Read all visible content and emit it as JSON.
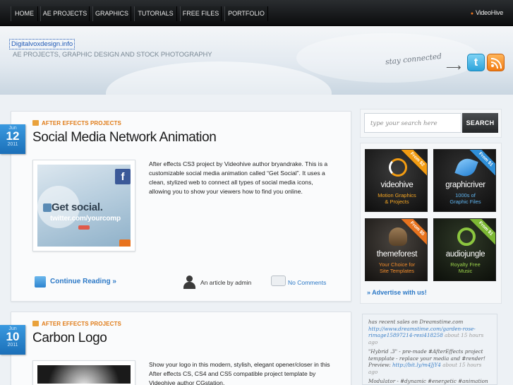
{
  "nav": {
    "items": [
      "HOME",
      "AE PROJECTS",
      "GRAPHICS",
      "TUTORIALS",
      "FREE FILES",
      "PORTFOLIO"
    ],
    "right_link": "VideoHive"
  },
  "header": {
    "site_title": "Digitalvoxdesign.info",
    "tagline": "AE PROJECTS, GRAPHIC DESIGN AND STOCK PHOTOGRAPHY",
    "stay_connected": "stay connected",
    "twitter_icon": "twitter-icon",
    "rss_icon": "rss-icon"
  },
  "posts": [
    {
      "date": {
        "month": "Jun",
        "day": "12",
        "year": "2011"
      },
      "category": "AFTER EFFECTS PROJECTS",
      "title": "Social Media Network Animation",
      "thumb_text": "Get social.",
      "thumb_sub": "twitter.com/yourcomp",
      "excerpt": "After effects CS3 project by Videohive author bryandrake. This is a customizable social media animation called “Get Social”. It uses a clean, stylized web to connect all types of social media icons, allowing you to show your viewers how to find you online.",
      "continue": "Continue Reading »",
      "byline": "An article by admin",
      "comments": "No Comments"
    },
    {
      "date": {
        "month": "Jun",
        "day": "10",
        "year": "2011"
      },
      "category": "AFTER EFFECTS PROJECTS",
      "title": "Carbon Logo",
      "excerpt": "Show your logo in this modern, stylish, elegant opener/closer in this After effects CS, CS4 and CS5 compatible project template by Videohive author CGstation."
    }
  ],
  "sidebar": {
    "search_placeholder": "type your search here",
    "search_button": "SEARCH",
    "ads": [
      {
        "name": "videohive",
        "sub1": "Motion Graphics",
        "sub2": "& Projects",
        "ribbon": "From $2",
        "color": "#f39c12"
      },
      {
        "name": "graphicriver",
        "sub1": "1000s of",
        "sub2": "Graphic Files",
        "ribbon": "From $1",
        "color": "#2f8fd8"
      },
      {
        "name": "themeforest",
        "sub1": "Your Choice for",
        "sub2": "Site Templates",
        "ribbon": "From $5",
        "color": "#e8731e"
      },
      {
        "name": "audiojungle",
        "sub1": "Royalty Free",
        "sub2": "Music",
        "ribbon": "From $1",
        "color": "#7db834"
      }
    ],
    "advertise": "» Advertise with us!",
    "tweets": {
      "intro": "has recent sales on Dreamstime.com",
      "t1_link": "http://www.dreamstime.com/garden-rose-rimage15897214-resi418258",
      "t1_time": "about 15 hours ago",
      "t2_text": "\"Hybrid .3\" - pre-made #AfterEffects project tempplate - replace your media and #render! Preview:",
      "t2_link": "http://bit.ly/m4JjY4",
      "t2_time": "about 15 hours ago",
      "t3_text": "Modulator - #dynamic #energetic #animation"
    }
  }
}
